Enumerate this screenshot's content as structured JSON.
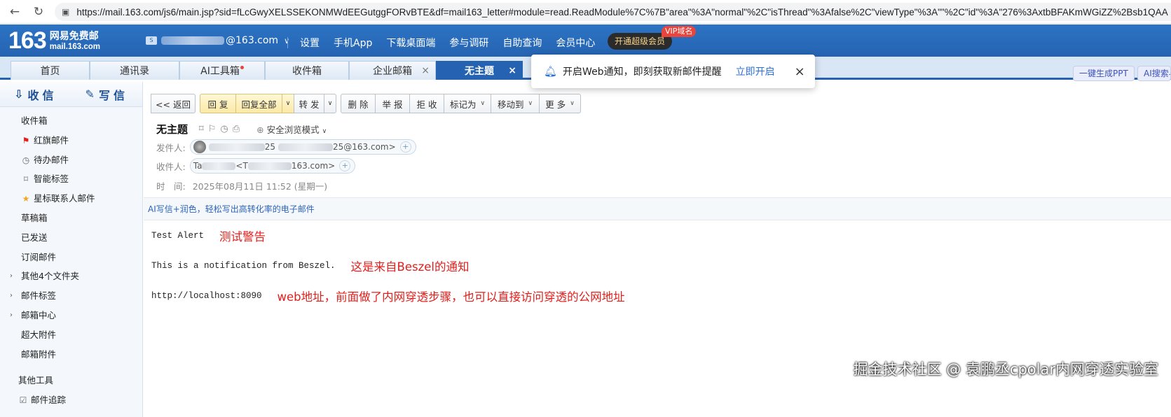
{
  "browser": {
    "url": "https://mail.163.com/js6/main.jsp?sid=fLcGwyXELSSEKONMWdEEGutggFORvBTE&df=mail163_letter#module=read.ReadModule%7C%7B\"area\"%3A\"normal\"%2C\"isThread\"%3Afalse%2C\"viewType\"%3A\"\"%2C\"id\"%3A\"276%3AxtbBFAKmWGiZZ%2Bsb1QAA"
  },
  "header": {
    "logo_number": "163",
    "logo_name": "网易免费邮",
    "logo_domain": "mail.163.com",
    "account_suffix": "@163.com",
    "account_caret": "∨",
    "links": [
      "设置",
      "手机App",
      "下载桌面端",
      "参与调研",
      "自助查询",
      "会员中心"
    ],
    "vip_button": "开通超级会员",
    "vip_badge": "VIP域名"
  },
  "tabs": [
    {
      "label": "首页"
    },
    {
      "label": "通讯录"
    },
    {
      "label": "AI工具箱"
    },
    {
      "label": "收件箱"
    },
    {
      "label": "企业邮箱"
    },
    {
      "label": "无主题"
    }
  ],
  "tab_close": "×",
  "pills": {
    "ppt": "一键生成PPT",
    "search": "AI搜索与"
  },
  "notification": {
    "text": "开启Web通知，即刻获取新邮件提醒",
    "action": "立即开启",
    "close": "×"
  },
  "sidebar": {
    "receive": "收信",
    "write": "写信",
    "items": [
      {
        "label": "收件箱"
      },
      {
        "label": "红旗邮件"
      },
      {
        "label": "待办邮件"
      },
      {
        "label": "智能标签"
      },
      {
        "label": "星标联系人邮件"
      },
      {
        "label": "草稿箱"
      },
      {
        "label": "已发送"
      },
      {
        "label": "订阅邮件"
      },
      {
        "label": "其他4个文件夹"
      },
      {
        "label": "邮件标签"
      },
      {
        "label": "邮箱中心"
      },
      {
        "label": "超大附件"
      },
      {
        "label": "邮箱附件"
      }
    ],
    "other_tools": "其他工具",
    "mail_track": "邮件追踪"
  },
  "toolbar": {
    "back": "<< 返回",
    "reply": "回 复",
    "reply_all": "回复全部",
    "forward": "转 发",
    "delete": "删 除",
    "report": "举 报",
    "reject": "拒 收",
    "mark_as": "标记为",
    "move_to": "移动到",
    "more": "更 多"
  },
  "mail": {
    "subject": "无主题",
    "safe_mode": "安全浏览模式",
    "from_label": "发件人:",
    "from_name_part": "25",
    "from_addr_part": "25@163.com>",
    "to_label": "收件人:",
    "to_name_part": "Ta",
    "to_addr_mid": "<T",
    "to_addr_part": "163.com>",
    "time_label": "时　间:",
    "time_value": "2025年08月11日 11:52 (星期一)",
    "ai_tip": "AI写信+润色，轻松写出高转化率的电子邮件",
    "body": [
      {
        "text": "Test Alert",
        "note": "测试警告"
      },
      {
        "text": "This is a notification from Beszel.",
        "note": "这是来自Beszel的通知"
      },
      {
        "text": "http://localhost:8090",
        "note": "web地址，前面做了内网穿透步骤，也可以直接访问穿透的公网地址"
      }
    ]
  },
  "watermark": "掘金技术社区 @ 袁鹏丞cpolar内网穿透实验室",
  "colors": {
    "header_blue": "#2563b2",
    "annotation_red": "#e0201c",
    "link_blue": "#2c6fd6"
  }
}
